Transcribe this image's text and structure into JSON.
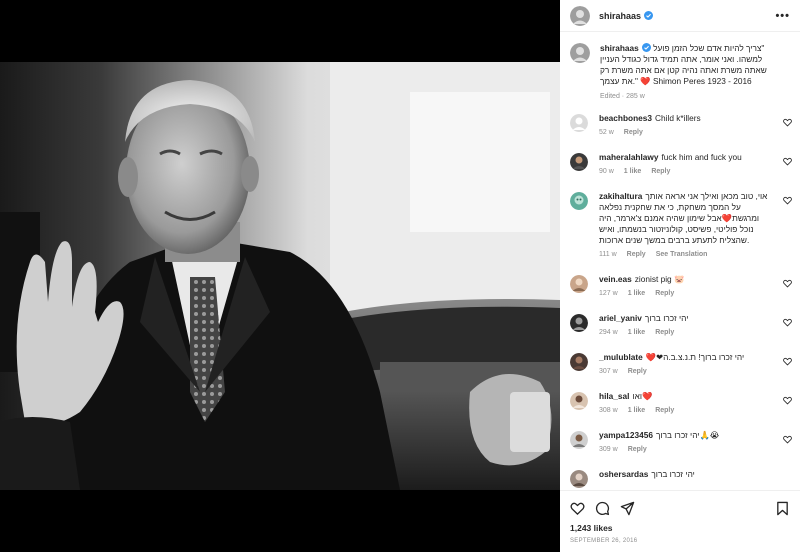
{
  "post": {
    "username": "shirahaas",
    "more_label": "•••",
    "caption_line1": "צריך להיות אדם שכל הזמן פועל\"",
    "caption_line2": "למשהו. ואני אומר, אתה תמיד גדול כגודל העניין",
    "caption_line3": "שאתה משרת ואתה נהיה קטן אם אתה משרת רק",
    "caption_line4_a": "את עצמך.\"",
    "caption_line4_b": "Shimon Peres 1923 - 2016",
    "caption_meta": "Edited · 285 w",
    "likes": "1,243 likes",
    "date": "SEPTEMBER 26, 2016"
  },
  "comments": [
    {
      "user": "beachbones3",
      "text": "Child k*illers",
      "time": "52 w",
      "likes": "",
      "reply": "Reply",
      "extra": ""
    },
    {
      "user": "maheralahlawy",
      "text": "fuck him and fuck you",
      "time": "90 w",
      "likes": "1 like",
      "reply": "Reply",
      "extra": ""
    },
    {
      "user": "zakihaltura",
      "text_line1": "אוי, טוב מכאן ואילך אני אראה אותך",
      "text_line2": "על המסך משחקת, כי את שחקנית נפלאה",
      "text_line3": "ומרגשת❤️אבל שימון שהיה אמנם צ'ארמר, היה",
      "text_line4": "נוכל פוליטי, פשיסט, קולוניזטור בנשמתו, ואיש",
      "text_line5": "שהצליח לתעתע ברבים במשך שנים ארוכות.",
      "time": "111 w",
      "likes": "",
      "reply": "Reply",
      "extra": "See Translation"
    },
    {
      "user": "vein.eas",
      "text": "zionist pig 🐷",
      "time": "127 w",
      "likes": "1 like",
      "reply": "Reply",
      "extra": ""
    },
    {
      "user": "ariel_yaniv",
      "text": "יהי זכרו ברוך",
      "time": "294 w",
      "likes": "1 like",
      "reply": "Reply",
      "extra": ""
    },
    {
      "user": "_mulublate",
      "text": "❤️❤יהי זכרו ברוך! ת.נ.צ.ב.ה",
      "time": "307 w",
      "likes": "",
      "reply": "Reply",
      "extra": ""
    },
    {
      "user": "hila_sal",
      "text": "ואו❤️",
      "time": "308 w",
      "likes": "1 like",
      "reply": "Reply",
      "extra": ""
    },
    {
      "user": "yampa123456",
      "text": "יהי זכרו ברוך🙏😭",
      "time": "309 w",
      "likes": "",
      "reply": "Reply",
      "extra": ""
    },
    {
      "user": "oshersardas",
      "text": "יהי זכרו ברוך",
      "time": "",
      "likes": "",
      "reply": "",
      "extra": ""
    }
  ],
  "icons": {
    "verified": "verified-badge-icon",
    "like": "heart-icon",
    "comment": "comment-icon",
    "share": "paper-plane-icon",
    "save": "bookmark-icon"
  },
  "colors": {
    "verified": "#3897f0",
    "heart": "#ed4956",
    "meta": "#8e8e8e",
    "text": "#262626"
  }
}
